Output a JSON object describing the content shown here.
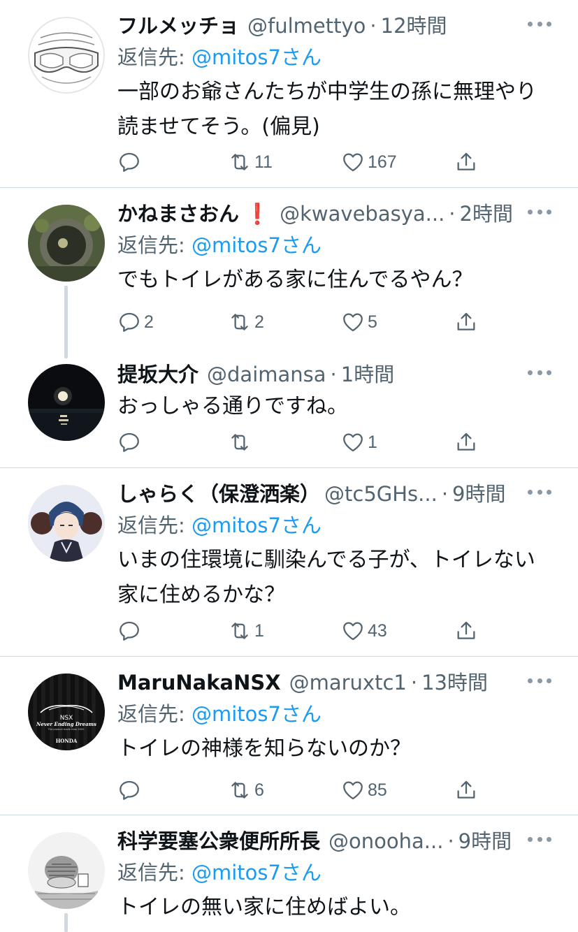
{
  "tweets": [
    {
      "name": "フルメッチョ",
      "handle": "@fulmettyo",
      "separator": "·",
      "time": "12時間",
      "reply_prefix": "返信先: ",
      "reply_mention": "@mitos7さん",
      "text_line1": "一部のお爺さんたちが中学生の孫に無理やり",
      "text_line2": "読ませてそう。(偏見)",
      "replies": "",
      "retweets": "11",
      "likes": "167",
      "avatar_icon": "goggles-avatar"
    },
    {
      "name": "かねまさおん",
      "name_emoji": "❗",
      "handle": "@kwavebasya...",
      "separator": "·",
      "time": "2時間",
      "reply_prefix": "返信先: ",
      "reply_mention": "@mitos7さん",
      "text_line1": "でもトイレがある家に住んでるやん？",
      "replies": "2",
      "retweets": "2",
      "likes": "5",
      "avatar_icon": "stone-tunnel-avatar"
    },
    {
      "name": "提坂大介",
      "handle": "@daimansa",
      "separator": "·",
      "time": "1時間",
      "text_line1": "おっしゃる通りですね。",
      "replies": "",
      "retweets": "",
      "likes": "1",
      "avatar_icon": "moon-night-avatar"
    },
    {
      "name": "しゃらく（保澄洒楽）",
      "handle": "@tc5GHs...",
      "separator": "·",
      "time": "9時間",
      "reply_prefix": "返信先: ",
      "reply_mention": "@mitos7さん",
      "text_line1": "いまの住環境に馴染んでる子が、トイレない",
      "text_line2": "家に住めるかな？",
      "replies": "",
      "retweets": "1",
      "likes": "43",
      "avatar_icon": "anime-character-avatar"
    },
    {
      "name": "MaruNakaNSX",
      "handle": "@maruxtc1",
      "separator": "·",
      "time": "13時間",
      "reply_prefix": "返信先: ",
      "reply_mention": "@mitos7さん",
      "text_line1": "トイレの神様を知らないのか？",
      "replies": "",
      "retweets": "6",
      "likes": "85",
      "avatar_icon": "nsx-logo-avatar",
      "avatar_text": {
        "nsx": "NSX",
        "slogan": "Never Ending Dreams",
        "subline": "The product made from 2002.",
        "brand": "HONDA"
      }
    },
    {
      "name": "科学要塞公衆便所所長",
      "handle": "@onooha...",
      "separator": "·",
      "time": "9時間",
      "reply_prefix": "返信先: ",
      "reply_mention": "@mitos7さん",
      "text_line1": "トイレの無い家に住めばよい。",
      "avatar_icon": "manga-sketch-avatar"
    }
  ],
  "colors": {
    "text": "#0f1419",
    "secondary": "#536471",
    "link": "#1d9bf0",
    "divider": "#cfd9de",
    "alert_red": "#e0245e"
  }
}
